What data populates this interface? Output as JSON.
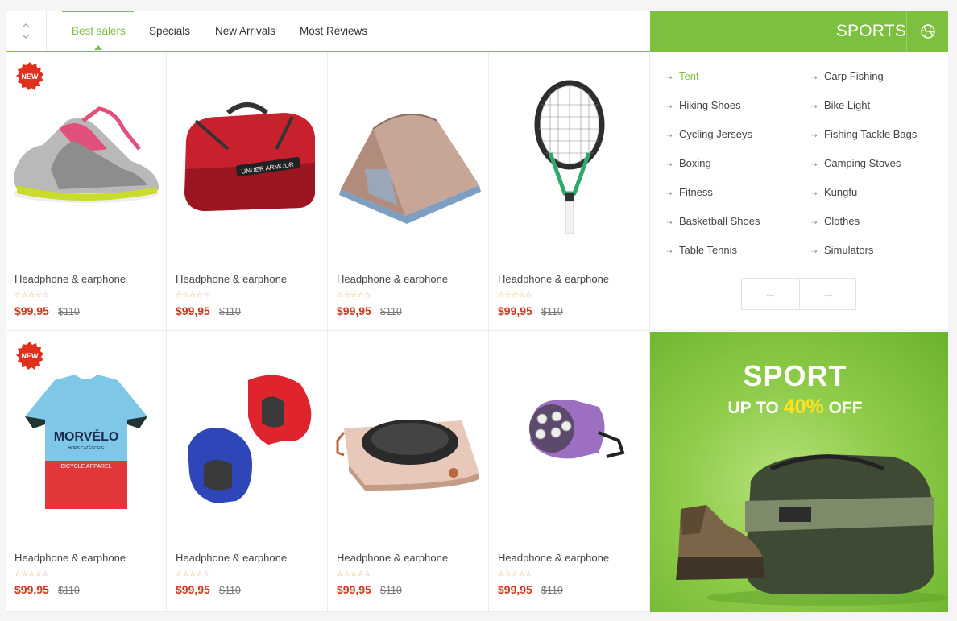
{
  "tabs": [
    {
      "label": "Best salers",
      "active": true
    },
    {
      "label": "Specials",
      "active": false
    },
    {
      "label": "New Arrivals",
      "active": false
    },
    {
      "label": "Most Reviews",
      "active": false
    }
  ],
  "products": [
    {
      "name": "Headphone & earphone",
      "price": "$99,95",
      "old_price": "$110",
      "badge": "NEW",
      "image": "running-shoes",
      "rating": 4
    },
    {
      "name": "Headphone & earphone",
      "price": "$99,95",
      "old_price": "$110",
      "badge": "",
      "image": "red-sports-bag",
      "rating": 4
    },
    {
      "name": "Headphone & earphone",
      "price": "$99,95",
      "old_price": "$110",
      "badge": "",
      "image": "camping-tent",
      "rating": 4
    },
    {
      "name": "Headphone & earphone",
      "price": "$99,95",
      "old_price": "$110",
      "badge": "",
      "image": "tennis-racket",
      "rating": 4
    },
    {
      "name": "Headphone & earphone",
      "price": "$99,95",
      "old_price": "$110",
      "badge": "NEW",
      "image": "cycling-jersey",
      "rating": 4
    },
    {
      "name": "Headphone & earphone",
      "price": "$99,95",
      "old_price": "$110",
      "badge": "",
      "image": "boxing-headguards",
      "rating": 4
    },
    {
      "name": "Headphone & earphone",
      "price": "$99,95",
      "old_price": "$110",
      "badge": "",
      "image": "camping-stove",
      "rating": 4
    },
    {
      "name": "Headphone & earphone",
      "price": "$99,95",
      "old_price": "$110",
      "badge": "",
      "image": "bike-light",
      "rating": 4
    }
  ],
  "jersey_text": {
    "brand": "MORVÉLO",
    "line1": "HORS CATÉGORIE",
    "line2": "BICYCLE APPAREL"
  },
  "bag_text": "UNDER ARMOUR",
  "sidebar": {
    "title": "SPORTS",
    "icon": "basketball-icon",
    "categories_left": [
      "Tent",
      "Hiking Shoes",
      "Cycling Jerseys",
      "Boxing",
      "Fitness",
      "Basketball Shoes",
      "Table Tennis"
    ],
    "categories_right": [
      "Carp Fishing",
      "Bike Light",
      "Fishing Tackle Bags",
      "Camping Stoves",
      "Kungfu",
      "Clothes",
      "Simulators"
    ],
    "active_category": "Tent",
    "prev_label": "←",
    "next_label": "→"
  },
  "banner": {
    "title": "SPORT",
    "sub_prefix": "UP TO ",
    "sub_percent": "40%",
    "sub_suffix": " OFF"
  },
  "colors": {
    "accent": "#7dbf3f",
    "price": "#d1361f",
    "badge": "#e0301e",
    "promo": "#ffe21f"
  }
}
